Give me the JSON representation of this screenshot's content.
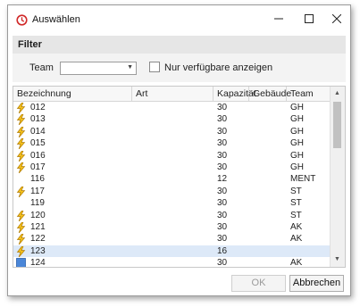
{
  "window": {
    "title": "Auswählen"
  },
  "filter": {
    "header": "Filter",
    "team_label": "Team",
    "team_value": "",
    "checkbox_label": "Nur verfügbare anzeigen",
    "checkbox_checked": false
  },
  "grid": {
    "columns": [
      "Bezeichnung",
      "Art",
      "Kapazität",
      "Gebäude",
      "Team"
    ],
    "rows": [
      {
        "icon": "lightning-icon",
        "name": "012",
        "art": "",
        "cap": "30",
        "gebaeude": "",
        "team": "GH"
      },
      {
        "icon": "lightning-icon",
        "name": "013",
        "art": "",
        "cap": "30",
        "gebaeude": "",
        "team": "GH"
      },
      {
        "icon": "lightning-icon",
        "name": "014",
        "art": "",
        "cap": "30",
        "gebaeude": "",
        "team": "GH"
      },
      {
        "icon": "lightning-icon",
        "name": "015",
        "art": "",
        "cap": "30",
        "gebaeude": "",
        "team": "GH"
      },
      {
        "icon": "lightning-icon",
        "name": "016",
        "art": "",
        "cap": "30",
        "gebaeude": "",
        "team": "GH"
      },
      {
        "icon": "lightning-icon",
        "name": "017",
        "art": "",
        "cap": "30",
        "gebaeude": "",
        "team": "GH"
      },
      {
        "icon": "",
        "name": "116",
        "art": "",
        "cap": "12",
        "gebaeude": "",
        "team": "MENT"
      },
      {
        "icon": "lightning-icon",
        "name": "117",
        "art": "",
        "cap": "30",
        "gebaeude": "",
        "team": "ST"
      },
      {
        "icon": "",
        "name": "119",
        "art": "",
        "cap": "30",
        "gebaeude": "",
        "team": "ST"
      },
      {
        "icon": "lightning-icon",
        "name": "120",
        "art": "",
        "cap": "30",
        "gebaeude": "",
        "team": "ST"
      },
      {
        "icon": "lightning-icon",
        "name": "121",
        "art": "",
        "cap": "30",
        "gebaeude": "",
        "team": "AK"
      },
      {
        "icon": "lightning-icon",
        "name": "122",
        "art": "",
        "cap": "30",
        "gebaeude": "",
        "team": "AK"
      },
      {
        "icon": "lightning-icon",
        "name": "123",
        "art": "",
        "cap": "16",
        "gebaeude": "",
        "team": ""
      },
      {
        "icon": "blue-square-icon",
        "name": "124",
        "art": "",
        "cap": "30",
        "gebaeude": "",
        "team": "AK"
      }
    ]
  },
  "buttons": {
    "ok": "OK",
    "cancel": "Abbrechen"
  },
  "colors": {
    "selected_row": "#dde9f8",
    "lightning": "#e3a814",
    "blue_square": "#4a86d8",
    "app_icon": "#d12a2a"
  }
}
